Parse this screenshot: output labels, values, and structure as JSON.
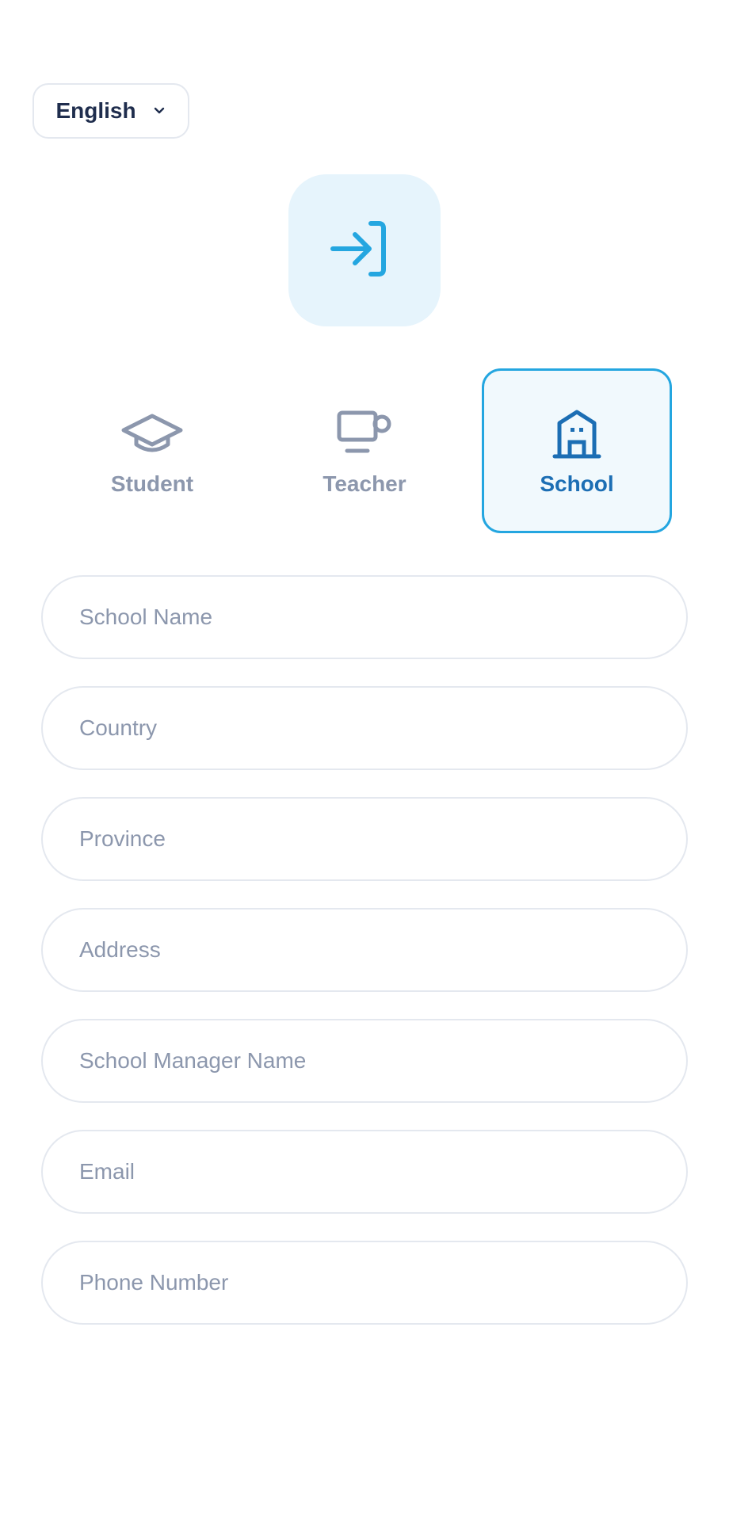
{
  "language": {
    "selected": "English",
    "icon": "chevron-down-icon"
  },
  "logo": {
    "icon": "login-icon",
    "accent": "#24a6e0",
    "background": "#e6f4fc"
  },
  "roles": [
    {
      "label": "Student",
      "icon": "graduation-cap-icon",
      "active": false
    },
    {
      "label": "Teacher",
      "icon": "monitor-mug-icon",
      "active": false
    },
    {
      "label": "School",
      "icon": "building-icon",
      "active": true
    }
  ],
  "form": {
    "school_name_placeholder": "School Name",
    "country_placeholder": "Country",
    "province_placeholder": "Province",
    "address_placeholder": "Address",
    "manager_placeholder": "School Manager Name",
    "email_placeholder": "Email",
    "phone_placeholder": "Phone Number"
  },
  "colors": {
    "active_border": "#24a6e0",
    "active_text": "#1c6eb4",
    "inactive": "#8c97ad",
    "field_border": "#e4e8ef"
  }
}
